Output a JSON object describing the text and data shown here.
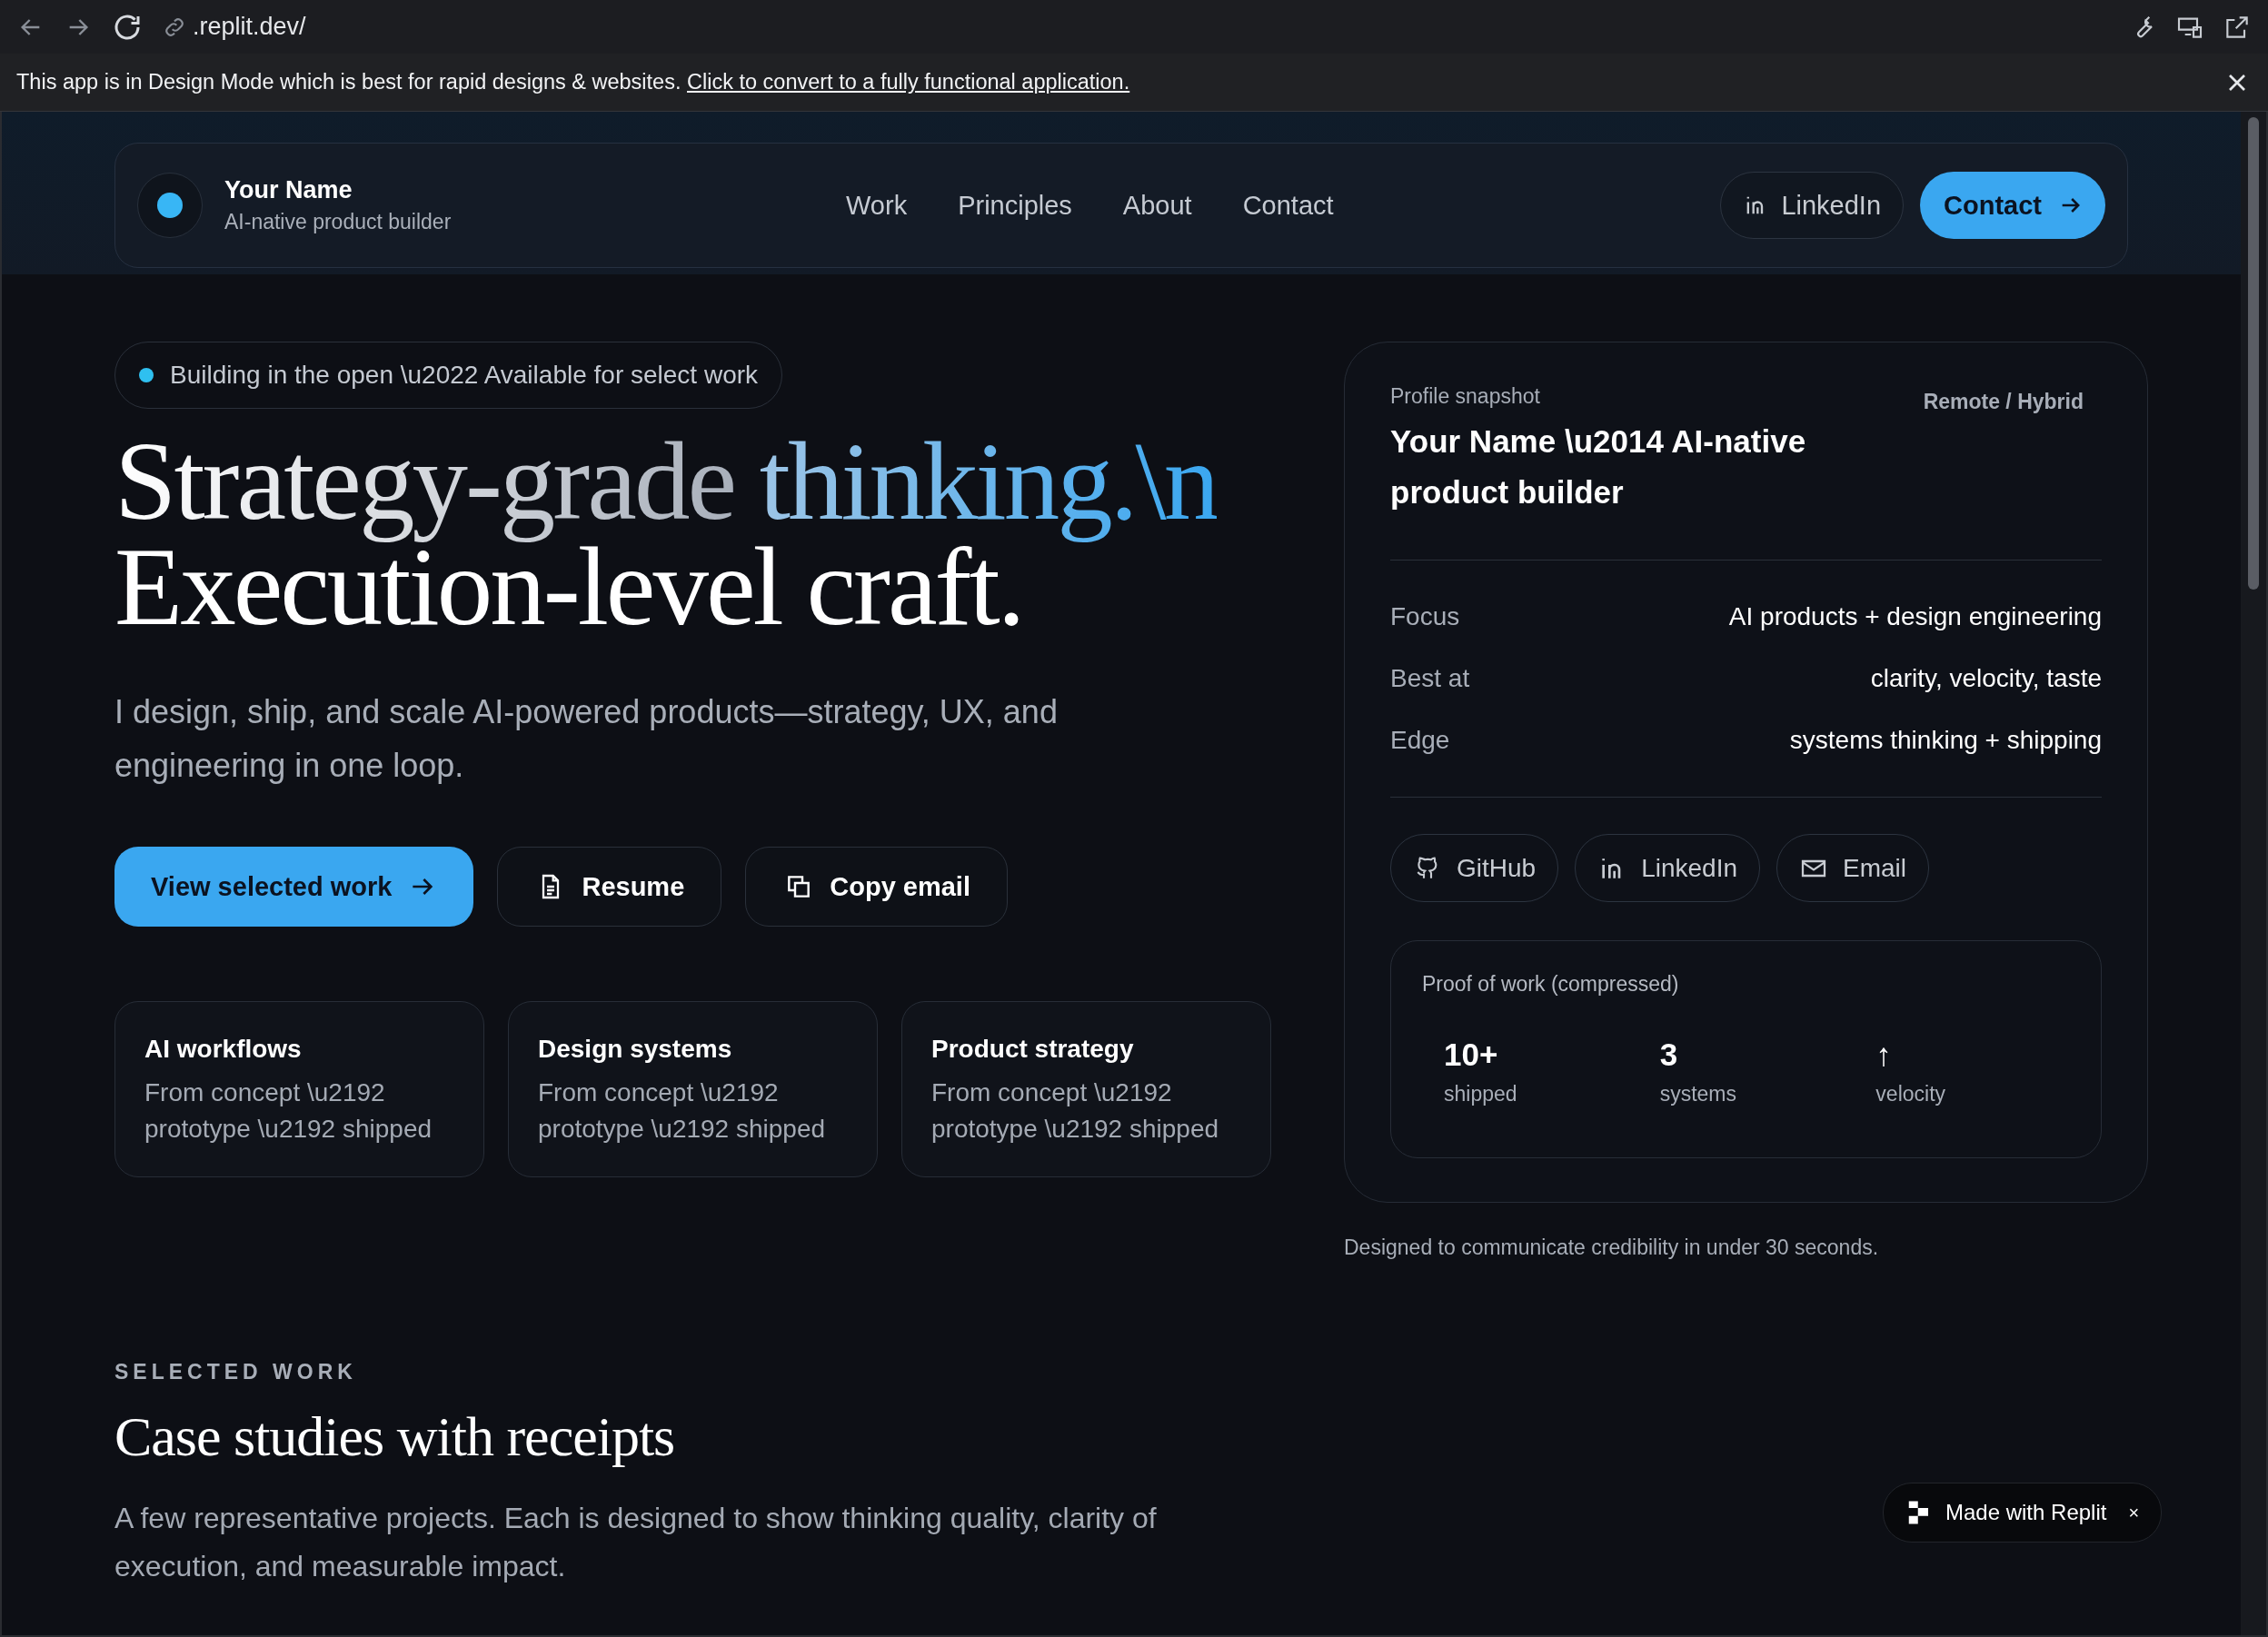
{
  "browser": {
    "url": ".replit.dev/"
  },
  "banner": {
    "text": "This app is in Design Mode which is best for rapid designs & websites.",
    "link": "Click to convert to a fully functional application."
  },
  "nav": {
    "name": "Your Name",
    "tagline": "AI-native product builder",
    "links": [
      "Work",
      "Principles",
      "About",
      "Contact"
    ],
    "linkedin": "LinkedIn",
    "contact": "Contact"
  },
  "hero": {
    "badge": "Building in the open \\u2022 Available for select work",
    "headline_plain": "Strategy-grade",
    "headline_accent": "thinking.\\n",
    "headline_line2": "Execution-level craft.",
    "intro": "I design, ship, and scale AI-powered products—strategy, UX, and engineering in one loop.",
    "buttons": [
      {
        "label": "View selected work",
        "kind": "primary"
      },
      {
        "label": "Resume",
        "kind": "resume"
      },
      {
        "label": "Copy email",
        "kind": "copy"
      }
    ],
    "cards": [
      {
        "title": "AI workflows",
        "text": "From concept \\u2192 prototype \\u2192 shipped"
      },
      {
        "title": "Design systems",
        "text": "From concept \\u2192 prototype \\u2192 shipped"
      },
      {
        "title": "Product strategy",
        "text": "From concept \\u2192 prototype \\u2192 shipped"
      }
    ]
  },
  "profile": {
    "label": "Profile snapshot",
    "title": "Your Name \\u2014 AI-native product builder",
    "location": "Remote / Hybrid",
    "rows": [
      {
        "key": "Focus",
        "value": "AI products + design engineering"
      },
      {
        "key": "Best at",
        "value": "clarity, velocity, taste"
      },
      {
        "key": "Edge",
        "value": "systems thinking + shipping"
      }
    ],
    "links": [
      {
        "label": "GitHub",
        "kind": "github"
      },
      {
        "label": "LinkedIn",
        "kind": "linkedin"
      },
      {
        "label": "Email",
        "kind": "email"
      }
    ],
    "proof_title": "Proof of work (compressed)",
    "stats": [
      {
        "value": "10+",
        "label": "shipped"
      },
      {
        "value": "3",
        "label": "systems"
      },
      {
        "value": "↑",
        "label": "velocity"
      }
    ],
    "caption": "Designed to communicate credibility in under 30 seconds."
  },
  "section": {
    "eyebrow": "SELECTED WORK",
    "title": "Case studies with receipts",
    "text": "A few representative projects. Each is designed to show thinking quality, clarity of execution, and measurable impact."
  },
  "made_with": {
    "label": "Made with Replit",
    "close": "×"
  }
}
